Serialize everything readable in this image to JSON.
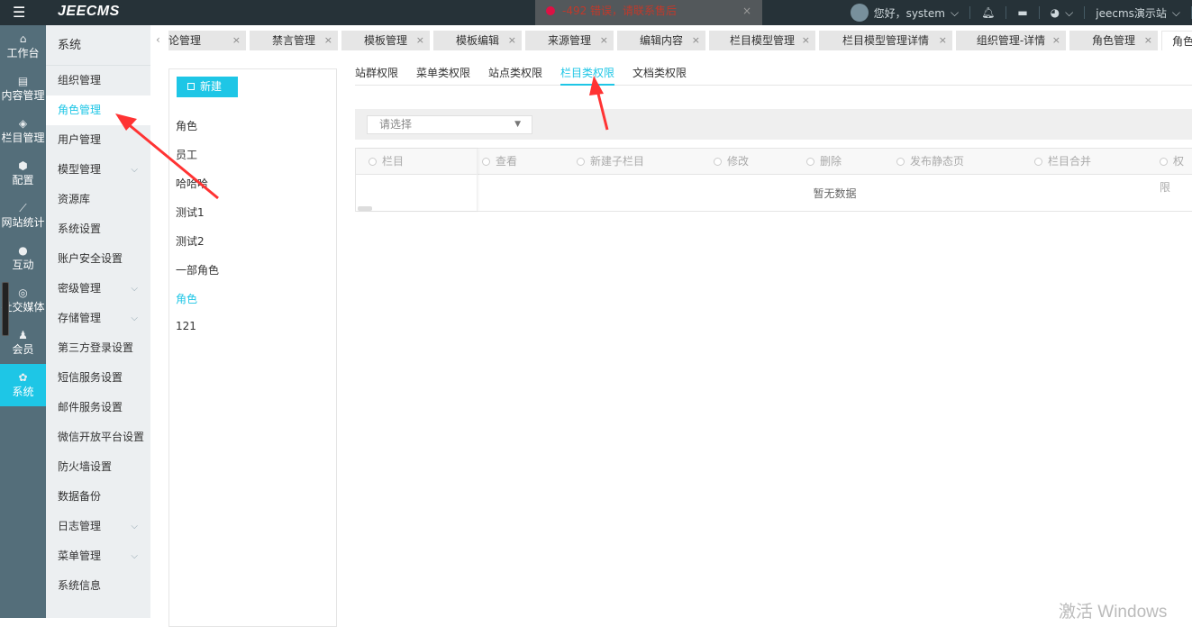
{
  "topbar": {
    "logo": "JEECMS",
    "greeting": "您好，system",
    "site": "jeecms演示站",
    "toast": "-492 错误，请联系售后",
    "toast_close": "×"
  },
  "iconbar": [
    {
      "label": "工作台",
      "icon": "home-icon",
      "glyph": "⌂"
    },
    {
      "label": "内容管理",
      "icon": "document-icon",
      "glyph": "▤"
    },
    {
      "label": "栏目管理",
      "icon": "layers-icon",
      "glyph": "◈"
    },
    {
      "label": "配置",
      "icon": "cube-icon",
      "glyph": "⬢"
    },
    {
      "label": "网站统计",
      "icon": "chart-icon",
      "glyph": "⟋"
    },
    {
      "label": "互动",
      "icon": "chat-icon",
      "glyph": "●"
    },
    {
      "label": "社交媒体",
      "icon": "target-icon",
      "glyph": "◎"
    },
    {
      "label": "会员",
      "icon": "member-icon",
      "glyph": "♟"
    },
    {
      "label": "系统",
      "icon": "gear-icon",
      "glyph": "✿"
    }
  ],
  "submenu": {
    "title": "系统",
    "items": [
      {
        "label": "组织管理"
      },
      {
        "label": "角色管理"
      },
      {
        "label": "用户管理"
      },
      {
        "label": "模型管理",
        "expand": "⌵"
      },
      {
        "label": "资源库"
      },
      {
        "label": "系统设置"
      },
      {
        "label": "账户安全设置"
      },
      {
        "label": "密级管理",
        "expand": "⌵"
      },
      {
        "label": "存储管理",
        "expand": "⌵"
      },
      {
        "label": "第三方登录设置"
      },
      {
        "label": "短信服务设置"
      },
      {
        "label": "邮件服务设置"
      },
      {
        "label": "微信开放平台设置"
      },
      {
        "label": "防火墙设置"
      },
      {
        "label": "数据备份"
      },
      {
        "label": "日志管理",
        "expand": "⌵"
      },
      {
        "label": "菜单管理",
        "expand": "⌵"
      },
      {
        "label": "系统信息"
      }
    ]
  },
  "tabs": [
    {
      "label": "论管理"
    },
    {
      "label": "禁言管理"
    },
    {
      "label": "模板管理"
    },
    {
      "label": "模板编辑"
    },
    {
      "label": "来源管理"
    },
    {
      "label": "编辑内容"
    },
    {
      "label": "栏目模型管理"
    },
    {
      "label": "栏目模型管理详情"
    },
    {
      "label": "组织管理-详情"
    },
    {
      "label": "角色管理"
    },
    {
      "label": "角色管"
    }
  ],
  "roles": {
    "new_button": "新建",
    "items": [
      "角色",
      "员工",
      "哈哈哈",
      "测试1",
      "测试2",
      "一部角色",
      "角色",
      "121"
    ]
  },
  "perm_tabs": [
    "站群权限",
    "菜单类权限",
    "站点类权限",
    "栏目类权限",
    "文档类权限"
  ],
  "filter": {
    "placeholder": "请选择"
  },
  "table": {
    "columns": [
      "栏目",
      "查看",
      "新建子栏目",
      "修改",
      "删除",
      "发布静态页",
      "栏目合并",
      "权限"
    ],
    "empty": "暂无数据"
  },
  "watermark": "激活 Windows",
  "colors": {
    "accent": "#1ec6e6",
    "topbar": "#263238",
    "iconbar": "#546e7a"
  }
}
